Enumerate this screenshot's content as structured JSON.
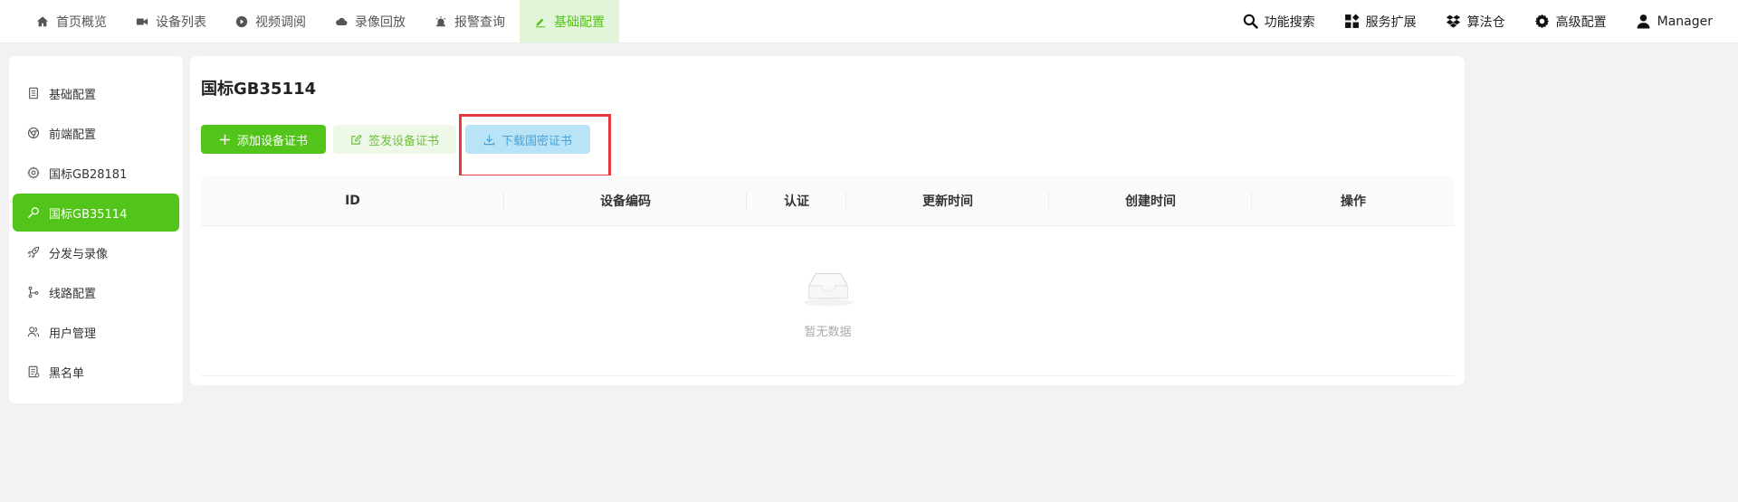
{
  "topnav": {
    "items": [
      {
        "label": "首页概览",
        "icon": "home-icon"
      },
      {
        "label": "设备列表",
        "icon": "video-camera-icon"
      },
      {
        "label": "视频调阅",
        "icon": "play-circle-icon"
      },
      {
        "label": "录像回放",
        "icon": "cloud-icon"
      },
      {
        "label": "报警查询",
        "icon": "alarm-icon"
      },
      {
        "label": "基础配置",
        "icon": "pencil-icon"
      }
    ],
    "active_index": 5
  },
  "tools": {
    "search_label": "功能搜索",
    "extend_label": "服务扩展",
    "algo_label": "算法仓",
    "settings_label": "高级配置",
    "user_label": "Manager"
  },
  "sidebar": {
    "items": [
      {
        "label": "基础配置",
        "icon": "document-icon"
      },
      {
        "label": "前端配置",
        "icon": "chrome-icon"
      },
      {
        "label": "国标GB28181",
        "icon": "gear-icon"
      },
      {
        "label": "国标GB35114",
        "icon": "key-icon"
      },
      {
        "label": "分发与录像",
        "icon": "rocket-icon"
      },
      {
        "label": "线路配置",
        "icon": "branch-icon"
      },
      {
        "label": "用户管理",
        "icon": "users-icon"
      },
      {
        "label": "黑名单",
        "icon": "list-icon"
      }
    ],
    "active_index": 3
  },
  "main": {
    "title": "国标GB35114",
    "buttons": {
      "add": "添加设备证书",
      "sign": "签发设备证书",
      "download": "下载国密证书"
    },
    "table": {
      "columns": [
        "ID",
        "设备编码",
        "认证",
        "更新时间",
        "创建时间",
        "操作"
      ],
      "empty_text": "暂无数据"
    }
  },
  "colors": {
    "primary": "#52c41a",
    "highlight": "#e0393e",
    "download_bg": "#b9e3f7"
  }
}
